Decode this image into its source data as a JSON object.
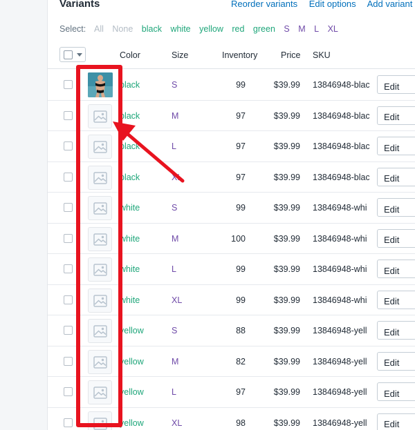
{
  "header": {
    "title": "Variants",
    "actions": [
      "Reorder variants",
      "Edit options",
      "Add variant"
    ]
  },
  "select": {
    "label": "Select:",
    "all": "All",
    "none": "None",
    "colors": [
      "black",
      "white",
      "yellow",
      "red",
      "green"
    ],
    "sizes": [
      "S",
      "M",
      "L",
      "XL"
    ]
  },
  "table": {
    "columns": [
      "Color",
      "Size",
      "Inventory",
      "Price",
      "SKU"
    ],
    "edit_label": "Edit",
    "rows": [
      {
        "color": "black",
        "size": "S",
        "inventory": "99",
        "price": "$39.99",
        "sku": "13846948-blac",
        "image": "photo"
      },
      {
        "color": "black",
        "size": "M",
        "inventory": "97",
        "price": "$39.99",
        "sku": "13846948-blac",
        "image": "placeholder"
      },
      {
        "color": "black",
        "size": "L",
        "inventory": "97",
        "price": "$39.99",
        "sku": "13846948-blac",
        "image": "placeholder"
      },
      {
        "color": "black",
        "size": "XL",
        "inventory": "97",
        "price": "$39.99",
        "sku": "13846948-blac",
        "image": "placeholder"
      },
      {
        "color": "white",
        "size": "S",
        "inventory": "99",
        "price": "$39.99",
        "sku": "13846948-whi",
        "image": "placeholder"
      },
      {
        "color": "white",
        "size": "M",
        "inventory": "100",
        "price": "$39.99",
        "sku": "13846948-whi",
        "image": "placeholder"
      },
      {
        "color": "white",
        "size": "L",
        "inventory": "99",
        "price": "$39.99",
        "sku": "13846948-whi",
        "image": "placeholder"
      },
      {
        "color": "white",
        "size": "XL",
        "inventory": "99",
        "price": "$39.99",
        "sku": "13846948-whi",
        "image": "placeholder"
      },
      {
        "color": "yellow",
        "size": "S",
        "inventory": "88",
        "price": "$39.99",
        "sku": "13846948-yell",
        "image": "placeholder"
      },
      {
        "color": "yellow",
        "size": "M",
        "inventory": "82",
        "price": "$39.99",
        "sku": "13846948-yell",
        "image": "placeholder"
      },
      {
        "color": "yellow",
        "size": "L",
        "inventory": "97",
        "price": "$39.99",
        "sku": "13846948-yell",
        "image": "placeholder"
      },
      {
        "color": "yellow",
        "size": "XL",
        "inventory": "98",
        "price": "$39.99",
        "sku": "13846948-yell",
        "image": "placeholder"
      }
    ]
  },
  "colors": {
    "link": "#006fbb",
    "option_color": "#1fa67a",
    "option_size": "#6f4aa8",
    "annotation": "#e8131f"
  }
}
